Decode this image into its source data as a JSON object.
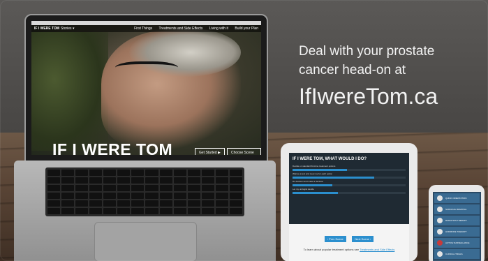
{
  "headline": {
    "line1": "Deal with your prostate",
    "line2": "cancer head-on at",
    "url": "IfIwereTom.ca"
  },
  "laptop": {
    "menubar_app": "Finder",
    "brand": "IF I WERE TOM",
    "stories": "Stories ▾",
    "nav_links": [
      "First Things",
      "Treatments and Side Effects",
      "Living with it",
      "Build your Plan"
    ],
    "hero_title": "IF I WERE TOM",
    "btn_get_started": "Get Started ▶",
    "btn_choose_scene": "Choose Scene ▶"
  },
  "tablet": {
    "title": "IF I WERE TOM, WHAT WOULD I DO?",
    "options": [
      {
        "label": "Decide on standard first-line treatment options",
        "value": 0.48
      },
      {
        "label": "Wait as a test and meet me for each option",
        "value": 0.72
      },
      {
        "label": "Do decision and make a decision",
        "value": 0.35
      },
      {
        "label": "Let my urologist decide",
        "value": 0.4
      }
    ],
    "prev_button": "‹ Prev Scene",
    "next_button": "Next Scene ›",
    "footer_text": "To learn about popular treatment options see",
    "footer_link": "Treatments and Side Effects"
  },
  "phone": {
    "items": [
      "QUICK ORIENTATION",
      "SURGICAL REMOVAL",
      "RADIATION THERAPY",
      "HORMONE THERAPY",
      "ACTIVE SURVEILLANCE",
      "CLINICAL TRIALS"
    ]
  },
  "colors": {
    "accent": "#2b8fce",
    "headline_text": "#f2f2f2"
  }
}
